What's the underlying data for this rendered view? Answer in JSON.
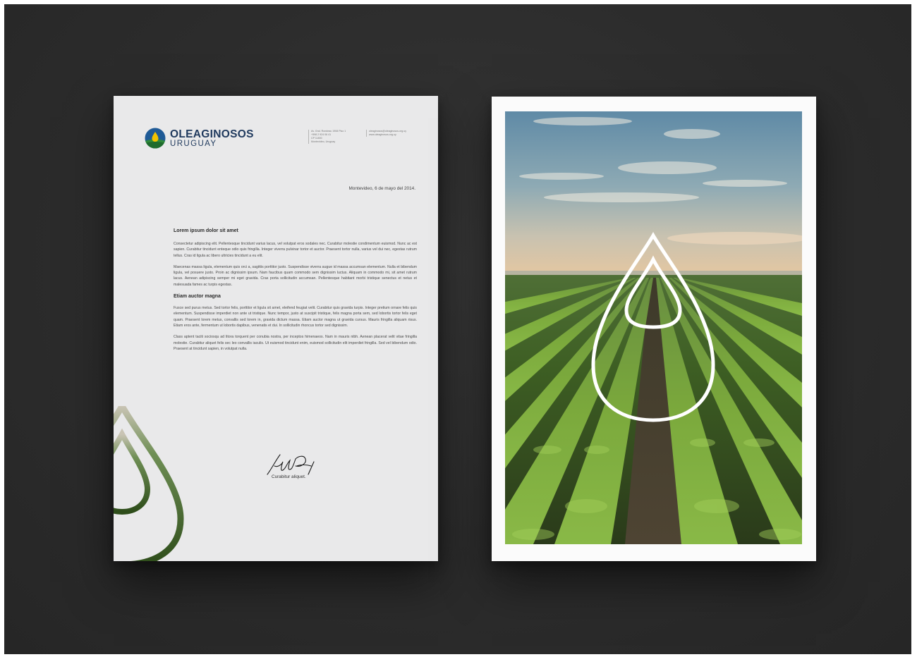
{
  "letterhead": {
    "brand": {
      "line1": "OLEAGINOSOS",
      "line2": "URUGUAY"
    },
    "contact_left": [
      "Av. Gral. Rondeau 1908 Piso 1",
      "+598 2 924 06 41",
      "CP 11800",
      "Montevideo, Uruguay"
    ],
    "contact_right": [
      "oleaginosos@oleaginosos.org.uy",
      "www.oleaginosos.org.uy"
    ],
    "date": "Montevideo, 6 de mayo del 2014.",
    "heading": "Lorem ipsum dolor sit amet",
    "paragraphs": [
      "Consectetur adipiscing elit. Pellentesque tincidunt varius lacus, vel volutpat eros sodales nec. Curabitur molestie condimentum euismod. Nunc ac est sapien. Curabitur tincidunt enteque odio quis fringilla. Integer viverra pulvinar tortor et auctor. Praesent tortor nulla, varius vel dui nec, egestas rutrum tellus. Cras id ligula ac libero ultricies tincidunt a eu elit.",
      "Maecenas massa ligula, elementum quis orci a, sagittis porttitor justo. Suspendisse viverra augue id massa accumsan elementum. Nulla et bibendum ligula, vel posuere justo. Proin ac dignissim ipsum. Nam faucibus quam commodo sem dignissim luctus. Aliquam in commodo mi, sit amet rutrum lacus. Aenean adipiscing semper mi eget gravida. Cras porta sollicitudin accumsan. Pellentesque habitant morbi tristique senectus et netus et malesuada fames ac turpis egestas."
    ],
    "subheading": "Etiam auctor magna",
    "paragraphs2": [
      "Fusce sed purus metus. Sed tortor felis, porttitor et ligula sit amet, eleifend feugiat velit. Curabitur quis gravida turpis. Integer pretium ornare felis quis elementum. Suspendisse imperdiet non ante ut tristique. Nunc tempor, justo at suscipit tristique, felis magna porta sem, sed lobortis tortor felis eget quam. Praesent lorem metus, convallis sed lorem in, gravida dictum massa. Etiam auctor magna ut gravida cursus. Mauris fringilla aliquam risus. Etiam eros ante, fermentum ut lobortis dapibus, venenatis et dui. In sollicitudin rhoncus tortor sed dignissim.",
      "Class aptent taciti sociosqu ad litora torquent per conubia nostra, per inceptos himenaeos. Nam in mauris nibh. Aenean placerat velit vitae fringilla molestie. Curabitur aliquet felis sec leo convallis iaculis. Ut euismod tincidunt enim, euismod sollicitudin elit imperdiet fringilla. Sed vel bibendum odio. Praesent at tincidunt sapien, in volutpat nulla."
    ],
    "signature_name": "Curabitur aliquet."
  },
  "colors": {
    "brand_navy": "#203a5e",
    "logo_blue": "#1f5a96",
    "logo_yellow": "#f2c200",
    "logo_green": "#2f8a3a",
    "background": "#2f2f2f"
  },
  "icons": {
    "logo": "oil-drop-logo-icon",
    "poster_mark": "oil-drop-outline-icon"
  }
}
